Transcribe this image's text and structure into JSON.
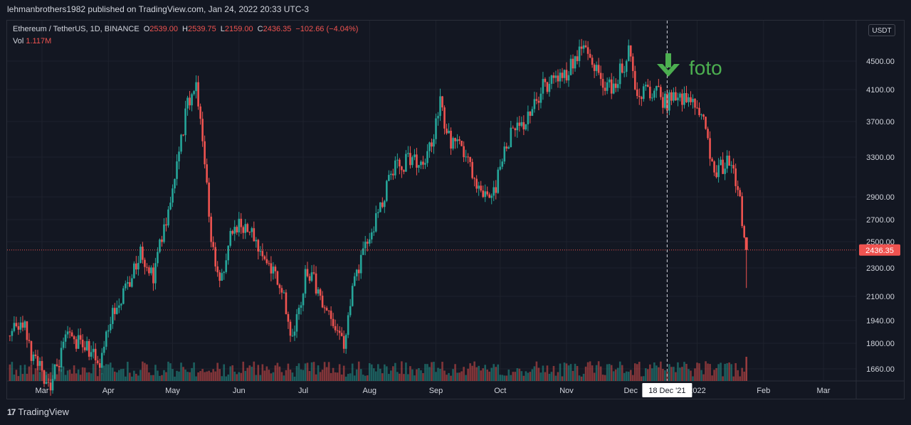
{
  "header": {
    "published_text": "lehmanbrothers1982 published on TradingView.com, Jan 24, 2022 20:33 UTC-3"
  },
  "legend": {
    "symbol": "Ethereum / TetherUS, 1D, BINANCE",
    "open_label": "O",
    "open": "2539.00",
    "high_label": "H",
    "high": "2539.75",
    "low_label": "L",
    "low": "2159.00",
    "close_label": "C",
    "close": "2436.35",
    "change": "−102.66 (−4.04%)",
    "vol_label": "Vol",
    "vol": "1.117M"
  },
  "currency_button": "USDT",
  "annotation": {
    "text": "foto",
    "icon": "arrow-down-icon",
    "color": "#4caf50"
  },
  "crosshair_date": "18 Dec '21",
  "last_price": "2436.35",
  "footer": {
    "logo_mark": "17",
    "brand": "TradingView"
  },
  "colors": {
    "up": "#26a69a",
    "down": "#ef5350",
    "background": "#131722",
    "grid": "#1e222d"
  },
  "chart_data": {
    "type": "candlestick",
    "title": "Ethereum / TetherUS, 1D, BINANCE",
    "y_ticks": [
      1660,
      1800,
      1940,
      2100,
      2300,
      2500,
      2700,
      2900,
      3300,
      3700,
      4100,
      4500
    ],
    "y_tick_labels": [
      "1660.00",
      "1800.00",
      "1940.00",
      "2100.00",
      "2300.00",
      "2500.00",
      "2700.00",
      "2900.00",
      "3300.00",
      "3700.00",
      "4100.00",
      "4500.00"
    ],
    "x_labels": [
      "Mar",
      "Apr",
      "May",
      "Jun",
      "Jul",
      "Aug",
      "Sep",
      "Oct",
      "Nov",
      "Dec",
      "2022",
      "Feb",
      "Mar"
    ],
    "x_label_dates": [
      "2021-03-01",
      "2021-04-01",
      "2021-05-01",
      "2021-06-01",
      "2021-07-01",
      "2021-08-01",
      "2021-09-01",
      "2021-10-01",
      "2021-11-01",
      "2021-12-01",
      "2022-01-01",
      "2022-02-01",
      "2022-03-01"
    ],
    "close_path": [
      [
        "2021-02-12",
        1800
      ],
      [
        "2021-02-20",
        1940
      ],
      [
        "2021-02-25",
        1700
      ],
      [
        "2021-03-05",
        1580
      ],
      [
        "2021-03-13",
        1840
      ],
      [
        "2021-03-20",
        1800
      ],
      [
        "2021-03-28",
        1700
      ],
      [
        "2021-04-02",
        1970
      ],
      [
        "2021-04-10",
        2150
      ],
      [
        "2021-04-16",
        2430
      ],
      [
        "2021-04-22",
        2250
      ],
      [
        "2021-05-01",
        2900
      ],
      [
        "2021-05-08",
        3900
      ],
      [
        "2021-05-12",
        4150
      ],
      [
        "2021-05-14",
        3800
      ],
      [
        "2021-05-19",
        2450
      ],
      [
        "2021-05-24",
        2200
      ],
      [
        "2021-05-29",
        2650
      ],
      [
        "2021-06-05",
        2650
      ],
      [
        "2021-06-12",
        2400
      ],
      [
        "2021-06-20",
        2200
      ],
      [
        "2021-06-26",
        1800
      ],
      [
        "2021-07-03",
        2300
      ],
      [
        "2021-07-08",
        2130
      ],
      [
        "2021-07-15",
        1950
      ],
      [
        "2021-07-20",
        1800
      ],
      [
        "2021-07-25",
        2200
      ],
      [
        "2021-08-05",
        2750
      ],
      [
        "2021-08-13",
        3250
      ],
      [
        "2021-08-20",
        3250
      ],
      [
        "2021-08-27",
        3200
      ],
      [
        "2021-09-03",
        3900
      ],
      [
        "2021-09-07",
        3500
      ],
      [
        "2021-09-14",
        3350
      ],
      [
        "2021-09-21",
        3000
      ],
      [
        "2021-09-28",
        2950
      ],
      [
        "2021-10-05",
        3500
      ],
      [
        "2021-10-15",
        3800
      ],
      [
        "2021-10-21",
        4150
      ],
      [
        "2021-10-31",
        4300
      ],
      [
        "2021-11-09",
        4700
      ],
      [
        "2021-11-16",
        4300
      ],
      [
        "2021-11-22",
        4100
      ],
      [
        "2021-11-30",
        4600
      ],
      [
        "2021-12-04",
        4100
      ],
      [
        "2021-12-10",
        4100
      ],
      [
        "2021-12-18",
        3950
      ],
      [
        "2021-12-27",
        4050
      ],
      [
        "2022-01-03",
        3750
      ],
      [
        "2022-01-10",
        3100
      ],
      [
        "2022-01-15",
        3300
      ],
      [
        "2022-01-20",
        3050
      ],
      [
        "2022-01-22",
        2600
      ],
      [
        "2022-01-24",
        2436.35
      ]
    ],
    "last_candle": {
      "open": 2539.0,
      "high": 2539.75,
      "low": 2159.0,
      "close": 2436.35,
      "volume": "1.117M"
    }
  }
}
